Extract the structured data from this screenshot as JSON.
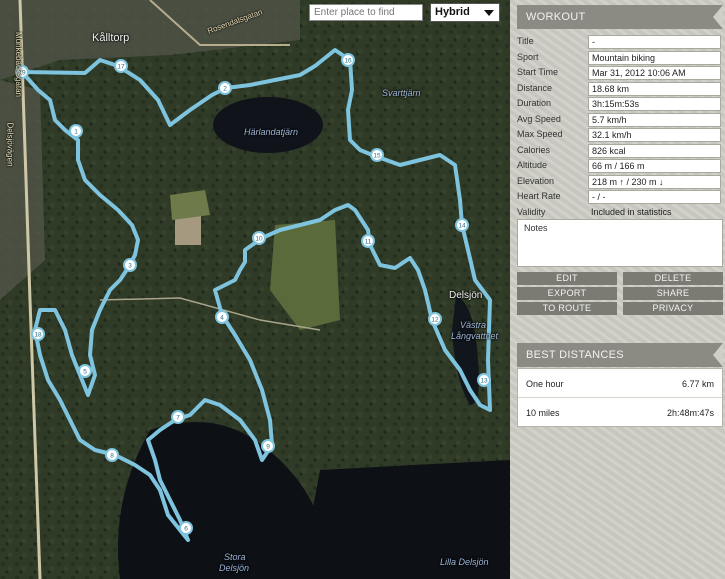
{
  "map": {
    "search_placeholder": "Enter place to find",
    "map_type": "Hybrid",
    "labels": {
      "kalltorp": "Kålltorp",
      "rosendal": "Rosendalsgatan",
      "munketorp": "Munkebäcksgatan",
      "delsjovagen": "Delsjövägen",
      "harlanda": "Härlandatjärn",
      "svarttjarn": "Svarttjärn",
      "delsjon": "Delsjön",
      "vastra": "Västra",
      "langvattnet": "Långvattnet",
      "stora1": "Stora",
      "stora2": "Delsjön",
      "lilla": "Lilla Delsjön"
    },
    "markers": [
      "1",
      "2",
      "3",
      "4",
      "5",
      "6",
      "7",
      "8",
      "9",
      "10",
      "11",
      "12",
      "13",
      "14",
      "15",
      "16",
      "17",
      "18",
      "19"
    ],
    "route_color": "#7fc4df"
  },
  "workout": {
    "header": "WORKOUT",
    "fields": [
      {
        "label": "Title",
        "value": "-"
      },
      {
        "label": "Sport",
        "value": "Mountain biking"
      },
      {
        "label": "Start Time",
        "value": "Mar 31, 2012 10:06 AM"
      },
      {
        "label": "Distance",
        "value": "18.68 km"
      },
      {
        "label": "Duration",
        "value": "3h:15m:53s"
      },
      {
        "label": "Avg Speed",
        "value": "5.7 km/h"
      },
      {
        "label": "Max Speed",
        "value": "32.1 km/h"
      },
      {
        "label": "Calories",
        "value": "826 kcal"
      },
      {
        "label": "Altitude",
        "value": "66 m / 166 m"
      },
      {
        "label": "Elevation",
        "value": "218 m ↑ / 230 m ↓"
      },
      {
        "label": "Heart Rate",
        "value": "- / -"
      },
      {
        "label": "Validity",
        "value": "Included in statistics"
      }
    ],
    "notes_label": "Notes",
    "buttons": {
      "edit": "EDIT",
      "delete": "DELETE",
      "export": "EXPORT",
      "share": "SHARE",
      "to_route": "TO ROUTE",
      "privacy": "PRIVACY"
    }
  },
  "best": {
    "header": "BEST DISTANCES",
    "rows": [
      {
        "label": "One hour",
        "value": "6.77 km"
      },
      {
        "label": "10 miles",
        "value": "2h:48m:47s"
      }
    ]
  }
}
